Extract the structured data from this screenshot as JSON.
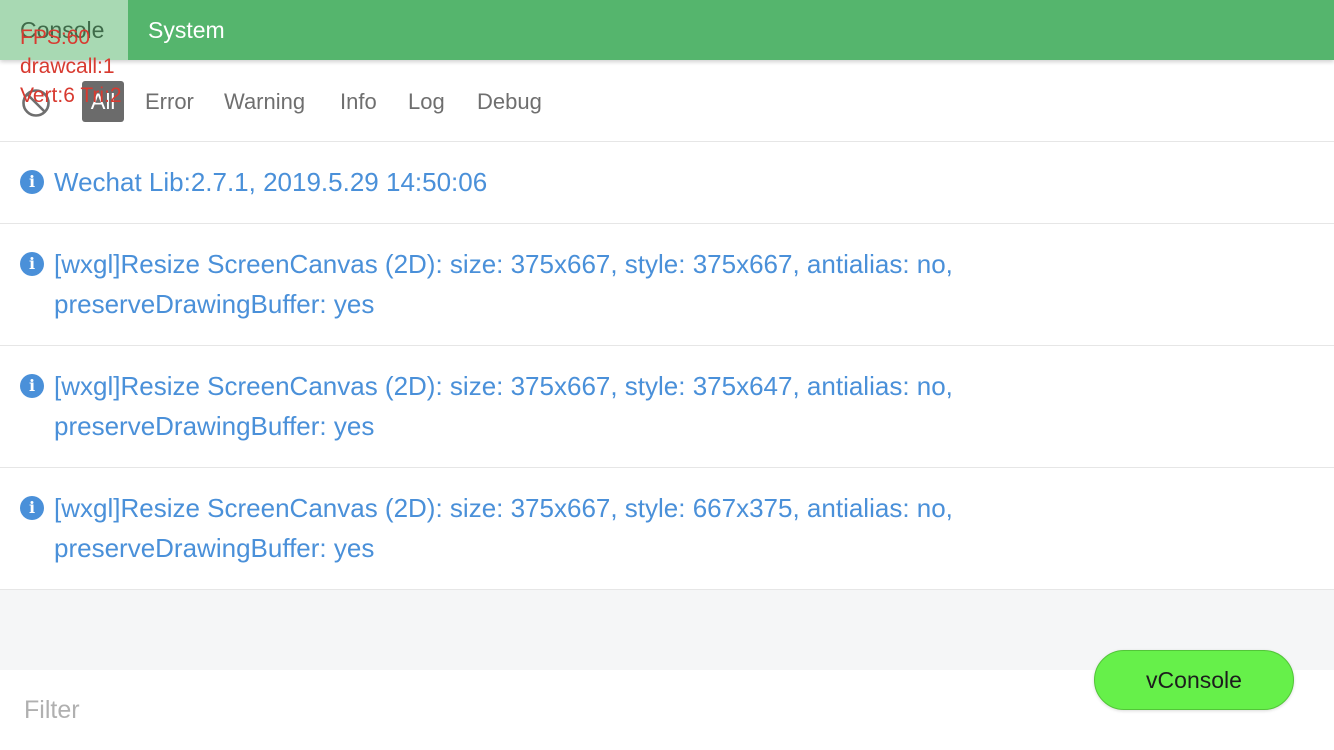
{
  "tabs": [
    {
      "label": "Console",
      "active": true
    },
    {
      "label": "System",
      "active": false
    }
  ],
  "toolbar": {
    "clear_icon": "clear-icon",
    "levels": [
      "All",
      "Error",
      "Warning",
      "Info",
      "Log",
      "Debug"
    ],
    "selected_level": "All"
  },
  "logs": [
    {
      "level": "info",
      "icon": "info-icon",
      "text": "Wechat Lib:2.7.1, 2019.5.29 14:50:06"
    },
    {
      "level": "info",
      "icon": "info-icon",
      "text": "[wxgl]Resize ScreenCanvas (2D): size: 375x667, style: 375x667, antialias: no, preserveDrawingBuffer: yes"
    },
    {
      "level": "info",
      "icon": "info-icon",
      "text": "[wxgl]Resize ScreenCanvas (2D): size: 375x667, style: 375x647, antialias: no, preserveDrawingBuffer: yes"
    },
    {
      "level": "info",
      "icon": "info-icon",
      "text": "[wxgl]Resize ScreenCanvas (2D): size: 375x667, style: 667x375, antialias: no, preserveDrawingBuffer: yes"
    }
  ],
  "filter": {
    "placeholder": "Filter",
    "value": ""
  },
  "switch_button": {
    "label": "vConsole"
  },
  "stats": {
    "fps": "FPS:60",
    "drawcall": "drawcall:1",
    "vert_tri": "Vert:6 Tri:2"
  },
  "colors": {
    "topbar": "#55b56d",
    "active_tab": "#a8d9b3",
    "info_text": "#4a90d9",
    "switch_button": "#66f04a",
    "stats_text": "#d83a30"
  }
}
